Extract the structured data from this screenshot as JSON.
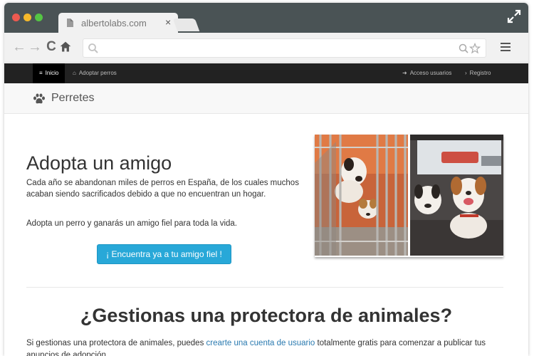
{
  "browser": {
    "tab_title": "albertolabs.com",
    "tab_close": "×",
    "address": ""
  },
  "sitenav": {
    "items_left": [
      {
        "label": "Inicio",
        "icon": "menu-icon"
      },
      {
        "label": "Adoptar perros",
        "icon": "home-icon"
      }
    ],
    "items_right": [
      {
        "label": "Acceso usuarios",
        "icon": "sign-in-icon"
      },
      {
        "label": "Registro",
        "icon": "chevron-right-icon"
      }
    ]
  },
  "header": {
    "brand": "Perretes",
    "brand_icon": "paw-icon"
  },
  "hero": {
    "title": "Adopta un amigo",
    "paragraph1": "Cada año se abandonan miles de perros en España, de los cuales muchos acaban siendo sacrificados debido a que no encuentran un hogar.",
    "paragraph2": "Adopta un perro y ganarás un amigo fiel para toda la vida.",
    "cta_label": "¡ Encuentra ya a tu amigo fiel !"
  },
  "section": {
    "title": "¿Gestionas una protectora de animales?",
    "text_before": "Si gestionas una protectora de animales, puedes ",
    "link": "crearte una cuenta de usuario",
    "text_after": " totalmente gratis para comenzar a publicar tus anuncios de adopción."
  },
  "colors": {
    "navbar": "#222222",
    "cta": "#28a8d8",
    "link": "#2a7ab0"
  }
}
